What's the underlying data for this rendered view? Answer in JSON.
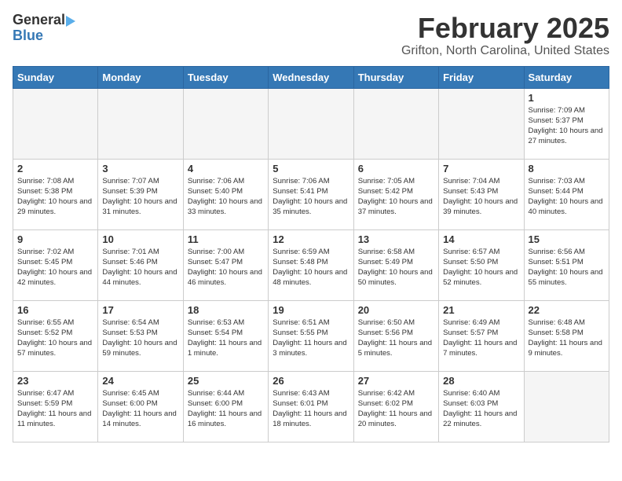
{
  "header": {
    "logo_general": "General",
    "logo_blue": "Blue",
    "title": "February 2025",
    "subtitle": "Grifton, North Carolina, United States"
  },
  "calendar": {
    "days_of_week": [
      "Sunday",
      "Monday",
      "Tuesday",
      "Wednesday",
      "Thursday",
      "Friday",
      "Saturday"
    ],
    "weeks": [
      [
        {
          "day": "",
          "info": ""
        },
        {
          "day": "",
          "info": ""
        },
        {
          "day": "",
          "info": ""
        },
        {
          "day": "",
          "info": ""
        },
        {
          "day": "",
          "info": ""
        },
        {
          "day": "",
          "info": ""
        },
        {
          "day": "1",
          "info": "Sunrise: 7:09 AM\nSunset: 5:37 PM\nDaylight: 10 hours and 27 minutes."
        }
      ],
      [
        {
          "day": "2",
          "info": "Sunrise: 7:08 AM\nSunset: 5:38 PM\nDaylight: 10 hours and 29 minutes."
        },
        {
          "day": "3",
          "info": "Sunrise: 7:07 AM\nSunset: 5:39 PM\nDaylight: 10 hours and 31 minutes."
        },
        {
          "day": "4",
          "info": "Sunrise: 7:06 AM\nSunset: 5:40 PM\nDaylight: 10 hours and 33 minutes."
        },
        {
          "day": "5",
          "info": "Sunrise: 7:06 AM\nSunset: 5:41 PM\nDaylight: 10 hours and 35 minutes."
        },
        {
          "day": "6",
          "info": "Sunrise: 7:05 AM\nSunset: 5:42 PM\nDaylight: 10 hours and 37 minutes."
        },
        {
          "day": "7",
          "info": "Sunrise: 7:04 AM\nSunset: 5:43 PM\nDaylight: 10 hours and 39 minutes."
        },
        {
          "day": "8",
          "info": "Sunrise: 7:03 AM\nSunset: 5:44 PM\nDaylight: 10 hours and 40 minutes."
        }
      ],
      [
        {
          "day": "9",
          "info": "Sunrise: 7:02 AM\nSunset: 5:45 PM\nDaylight: 10 hours and 42 minutes."
        },
        {
          "day": "10",
          "info": "Sunrise: 7:01 AM\nSunset: 5:46 PM\nDaylight: 10 hours and 44 minutes."
        },
        {
          "day": "11",
          "info": "Sunrise: 7:00 AM\nSunset: 5:47 PM\nDaylight: 10 hours and 46 minutes."
        },
        {
          "day": "12",
          "info": "Sunrise: 6:59 AM\nSunset: 5:48 PM\nDaylight: 10 hours and 48 minutes."
        },
        {
          "day": "13",
          "info": "Sunrise: 6:58 AM\nSunset: 5:49 PM\nDaylight: 10 hours and 50 minutes."
        },
        {
          "day": "14",
          "info": "Sunrise: 6:57 AM\nSunset: 5:50 PM\nDaylight: 10 hours and 52 minutes."
        },
        {
          "day": "15",
          "info": "Sunrise: 6:56 AM\nSunset: 5:51 PM\nDaylight: 10 hours and 55 minutes."
        }
      ],
      [
        {
          "day": "16",
          "info": "Sunrise: 6:55 AM\nSunset: 5:52 PM\nDaylight: 10 hours and 57 minutes."
        },
        {
          "day": "17",
          "info": "Sunrise: 6:54 AM\nSunset: 5:53 PM\nDaylight: 10 hours and 59 minutes."
        },
        {
          "day": "18",
          "info": "Sunrise: 6:53 AM\nSunset: 5:54 PM\nDaylight: 11 hours and 1 minute."
        },
        {
          "day": "19",
          "info": "Sunrise: 6:51 AM\nSunset: 5:55 PM\nDaylight: 11 hours and 3 minutes."
        },
        {
          "day": "20",
          "info": "Sunrise: 6:50 AM\nSunset: 5:56 PM\nDaylight: 11 hours and 5 minutes."
        },
        {
          "day": "21",
          "info": "Sunrise: 6:49 AM\nSunset: 5:57 PM\nDaylight: 11 hours and 7 minutes."
        },
        {
          "day": "22",
          "info": "Sunrise: 6:48 AM\nSunset: 5:58 PM\nDaylight: 11 hours and 9 minutes."
        }
      ],
      [
        {
          "day": "23",
          "info": "Sunrise: 6:47 AM\nSunset: 5:59 PM\nDaylight: 11 hours and 11 minutes."
        },
        {
          "day": "24",
          "info": "Sunrise: 6:45 AM\nSunset: 6:00 PM\nDaylight: 11 hours and 14 minutes."
        },
        {
          "day": "25",
          "info": "Sunrise: 6:44 AM\nSunset: 6:00 PM\nDaylight: 11 hours and 16 minutes."
        },
        {
          "day": "26",
          "info": "Sunrise: 6:43 AM\nSunset: 6:01 PM\nDaylight: 11 hours and 18 minutes."
        },
        {
          "day": "27",
          "info": "Sunrise: 6:42 AM\nSunset: 6:02 PM\nDaylight: 11 hours and 20 minutes."
        },
        {
          "day": "28",
          "info": "Sunrise: 6:40 AM\nSunset: 6:03 PM\nDaylight: 11 hours and 22 minutes."
        },
        {
          "day": "",
          "info": ""
        }
      ]
    ]
  }
}
